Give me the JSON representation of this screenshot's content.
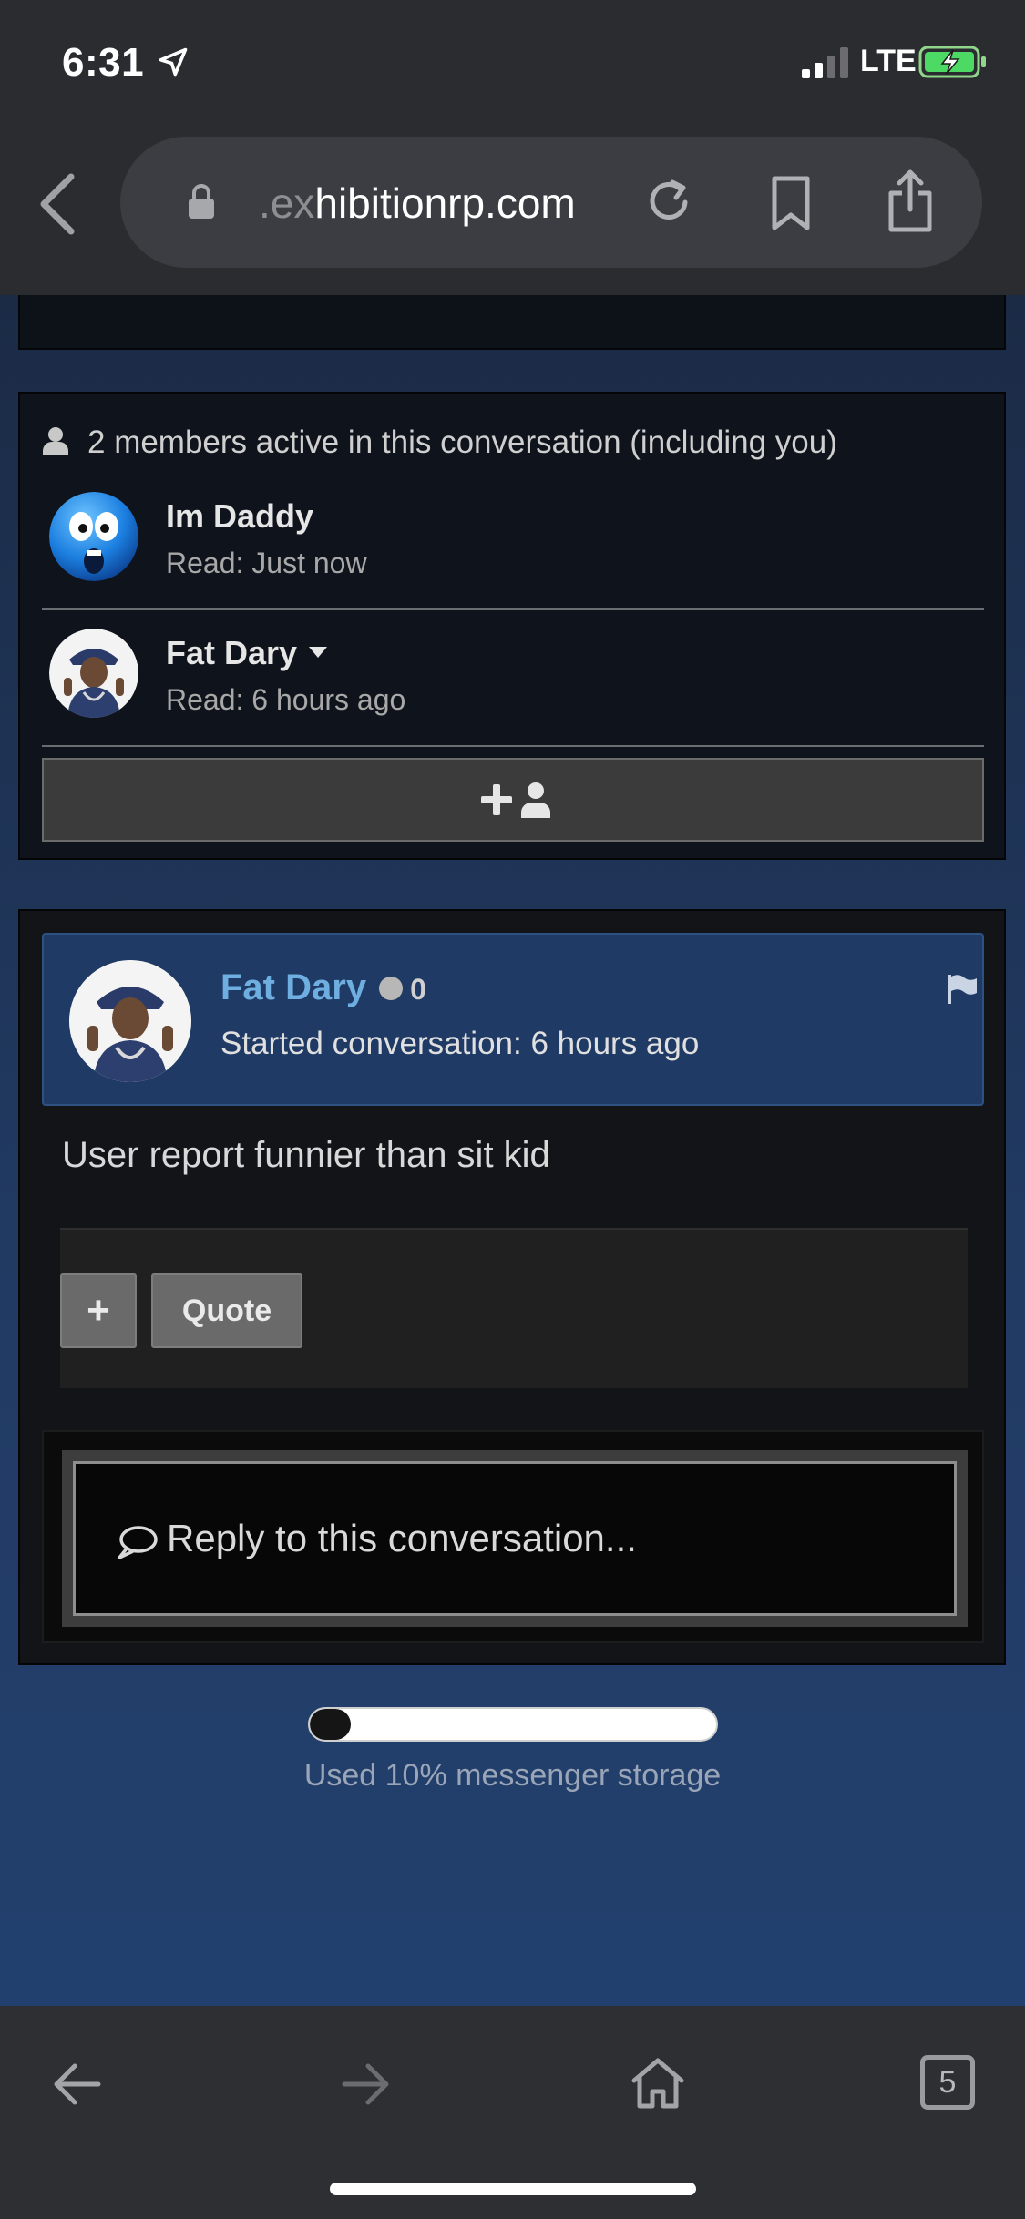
{
  "status_bar": {
    "time": "6:31",
    "carrier": "LTE",
    "icons": [
      "location-arrow-icon",
      "signal-icon",
      "battery-charging-icon"
    ]
  },
  "browser": {
    "url_faded": ".ex",
    "url_main": "hibitionrp.com",
    "icons": [
      "back-chevron-icon",
      "lock-icon",
      "reload-icon",
      "bookmark-icon",
      "share-icon"
    ]
  },
  "members": {
    "heading": "2 members active in this conversation (including you)",
    "list": [
      {
        "name": "Im Daddy",
        "read": "Read: Just now"
      },
      {
        "name": "Fat Dary",
        "read": "Read: 6 hours ago"
      }
    ],
    "invite_icon": "add-user-icon"
  },
  "message": {
    "author": "Fat Dary",
    "reaction_score": "0",
    "started": "Started conversation: 6 hours ago",
    "body": "User report funnier than sit kid",
    "plus_label": "+",
    "quote_label": "Quote"
  },
  "reply": {
    "placeholder": "Reply to this conversation..."
  },
  "storage": {
    "used_fraction": 0.1,
    "label": "Used 10% messenger storage"
  },
  "toolbar": {
    "tab_count": "5",
    "icons": [
      "back-arrow-icon",
      "forward-arrow-icon",
      "home-icon",
      "tabs-icon"
    ]
  },
  "colors": {
    "author_link": "#6eaee0",
    "header_bg": "#1f3a64",
    "chrome_bg": "#2b2c30"
  }
}
